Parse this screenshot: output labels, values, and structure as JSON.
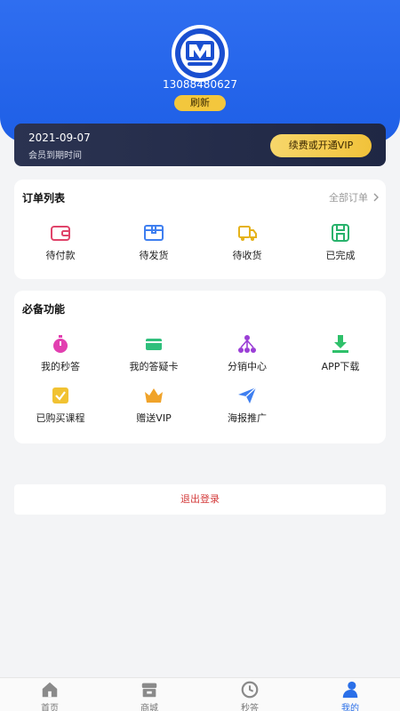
{
  "profile": {
    "phone": "13088480627",
    "refresh_label": "刷新"
  },
  "vip": {
    "date": "2021-09-07",
    "subtitle": "会员到期时间",
    "button": "续费或开通VIP"
  },
  "orders": {
    "title": "订单列表",
    "all_label": "全部订单",
    "items": [
      {
        "label": "待付款",
        "icon": "wallet-icon"
      },
      {
        "label": "待发货",
        "icon": "box-icon"
      },
      {
        "label": "待收货",
        "icon": "truck-icon"
      },
      {
        "label": "已完成",
        "icon": "save-icon"
      }
    ]
  },
  "functions": {
    "title": "必备功能",
    "items": [
      {
        "label": "我的秒答",
        "icon": "stopwatch-icon"
      },
      {
        "label": "我的答疑卡",
        "icon": "card-icon"
      },
      {
        "label": "分销中心",
        "icon": "network-icon"
      },
      {
        "label": "APP下载",
        "icon": "download-icon"
      },
      {
        "label": "已购买课程",
        "icon": "checkbox-icon"
      },
      {
        "label": "赠送VIP",
        "icon": "crown-icon"
      },
      {
        "label": "海报推广",
        "icon": "paper-plane-icon"
      }
    ]
  },
  "logout_label": "退出登录",
  "tabbar": {
    "items": [
      {
        "label": "首页",
        "icon": "home-icon",
        "active": false
      },
      {
        "label": "商城",
        "icon": "store-icon",
        "active": false
      },
      {
        "label": "秒答",
        "icon": "clock-icon",
        "active": false
      },
      {
        "label": "我的",
        "icon": "user-icon",
        "active": true
      }
    ]
  },
  "colors": {
    "primary": "#2a6fe8",
    "gold": "#f3c73d",
    "danger": "#d43c3c"
  }
}
